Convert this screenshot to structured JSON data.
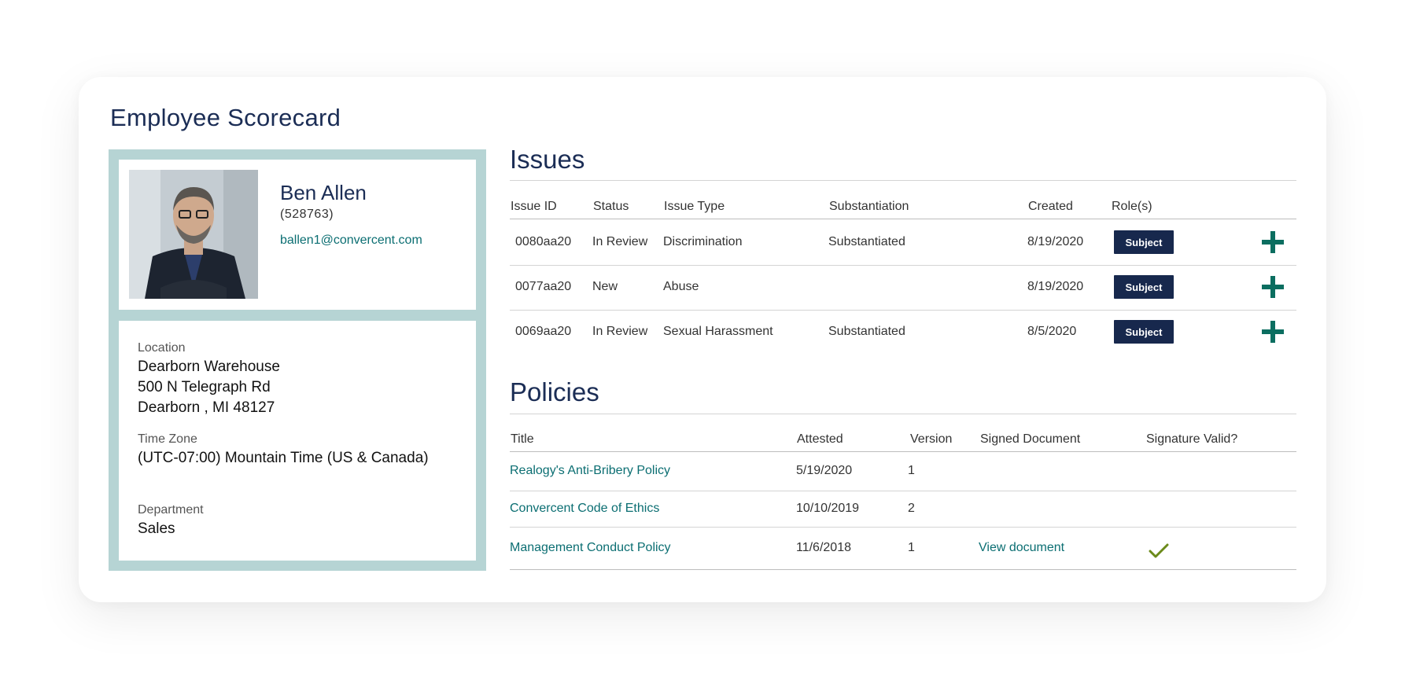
{
  "page": {
    "title": "Employee Scorecard"
  },
  "employee": {
    "name": "Ben Allen",
    "id": "(528763)",
    "email": "ballen1@convercent.com",
    "location_label": "Location",
    "location_lines": [
      "Dearborn Warehouse",
      "500 N Telegraph Rd",
      "Dearborn , MI 48127"
    ],
    "timezone_label": "Time Zone",
    "timezone": "(UTC-07:00) Mountain Time (US & Canada)",
    "department_label": "Department",
    "department": "Sales"
  },
  "issues": {
    "title": "Issues",
    "columns": [
      "Issue ID",
      "Status",
      "Issue Type",
      "Substantiation",
      "Created",
      "Role(s)"
    ],
    "rows": [
      {
        "id": "0080aa20",
        "status": "In Review",
        "type": "Discrimination",
        "substantiation": "Substantiated",
        "created": "8/19/2020",
        "role": "Subject"
      },
      {
        "id": "0077aa20",
        "status": "New",
        "type": "Abuse",
        "substantiation": "",
        "created": "8/19/2020",
        "role": "Subject"
      },
      {
        "id": "0069aa20",
        "status": "In Review",
        "type": "Sexual Harassment",
        "substantiation": "Substantiated",
        "created": "8/5/2020",
        "role": "Subject"
      }
    ]
  },
  "policies": {
    "title": "Policies",
    "columns": [
      "Title",
      "Attested",
      "Version",
      "Signed Document",
      "Signature Valid?"
    ],
    "rows": [
      {
        "title": "Realogy's Anti-Bribery Policy",
        "attested": "5/19/2020",
        "version": "1",
        "signed_document": "",
        "signature_valid": false
      },
      {
        "title": "Convercent Code of Ethics",
        "attested": "10/10/2019",
        "version": "2",
        "signed_document": "",
        "signature_valid": false
      },
      {
        "title": "Management Conduct Policy",
        "attested": "11/6/2018",
        "version": "1",
        "signed_document": "View document",
        "signature_valid": true
      }
    ]
  },
  "colors": {
    "accent": "#0b6e72",
    "navy": "#17284d",
    "panel": "#b6d4d4",
    "check": "#6b8a1a"
  },
  "icons": {
    "add": "plus-icon",
    "valid": "checkmark-icon"
  }
}
